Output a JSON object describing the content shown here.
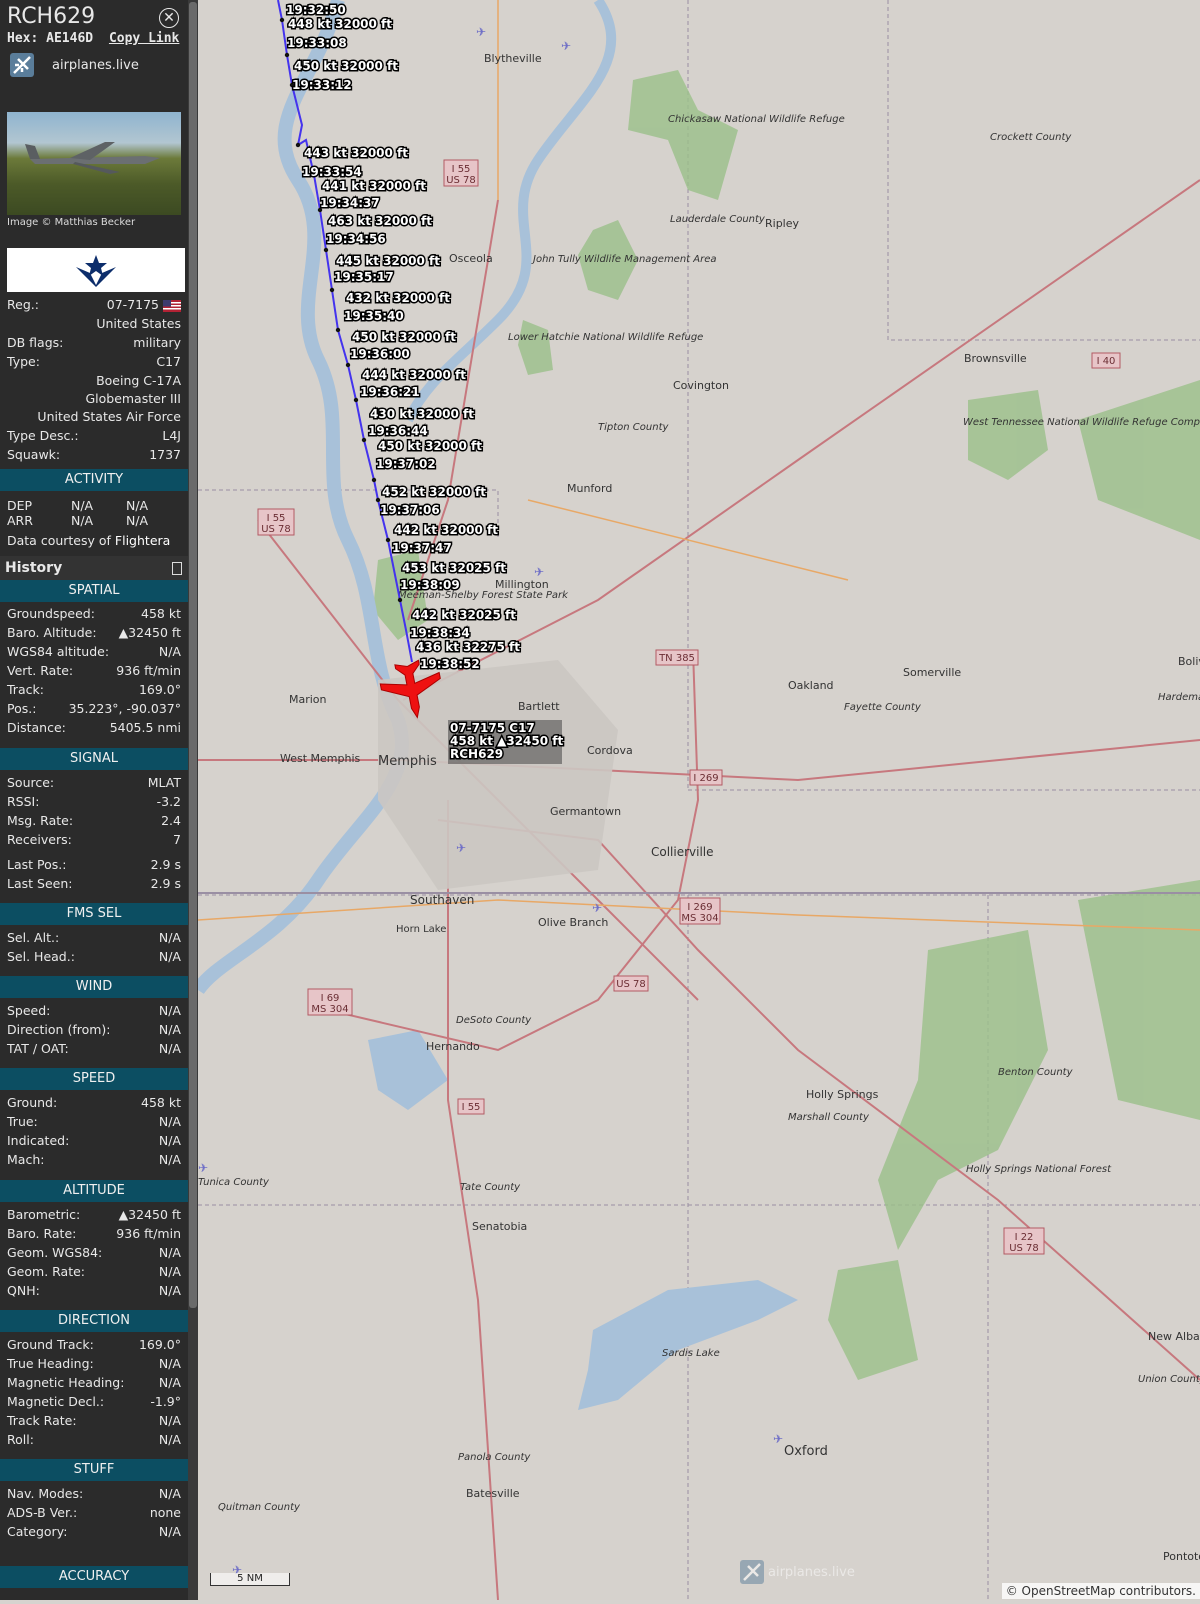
{
  "header": {
    "callsign": "RCH629",
    "hex_label": "Hex:",
    "hex": "AE146D",
    "copy_link": "Copy Link",
    "source_name": "airplanes.live",
    "photo_credit": "Image © Matthias Becker"
  },
  "details": {
    "reg_label": "Reg.:",
    "reg": "07-7175",
    "country": "United States",
    "dbflags_label": "DB flags:",
    "dbflags": "military",
    "type_label": "Type:",
    "type": "C17",
    "type_full": "Boeing C-17A Globemaster III",
    "operator": "United States Air Force",
    "typedesc_label": "Type Desc.:",
    "typedesc": "L4J",
    "squawk_label": "Squawk:",
    "squawk": "1737"
  },
  "activity": {
    "title": "ACTIVITY",
    "dep_label": "DEP",
    "dep1": "N/A",
    "dep2": "N/A",
    "arr_label": "ARR",
    "arr1": "N/A",
    "arr2": "N/A",
    "courtesy_prefix": "Data courtesy of",
    "courtesy_name": "Flightera"
  },
  "history_label": "History",
  "spatial": {
    "title": "SPATIAL",
    "rows": [
      {
        "label": "Groundspeed:",
        "value": "458 kt"
      },
      {
        "label": "Baro. Altitude:",
        "value": "▲32450 ft"
      },
      {
        "label": "WGS84 altitude:",
        "value": "N/A"
      },
      {
        "label": "Vert. Rate:",
        "value": "936 ft/min"
      },
      {
        "label": "Track:",
        "value": "169.0°"
      },
      {
        "label": "Pos.:",
        "value": "35.223°, -90.037°"
      },
      {
        "label": "Distance:",
        "value": "5405.5 nmi"
      }
    ]
  },
  "signal": {
    "title": "SIGNAL",
    "rows": [
      {
        "label": "Source:",
        "value": "MLAT"
      },
      {
        "label": "RSSI:",
        "value": "-3.2"
      },
      {
        "label": "Msg. Rate:",
        "value": "2.4"
      },
      {
        "label": "Receivers:",
        "value": "7"
      },
      {
        "label": "Last Pos.:",
        "value": "2.9 s"
      },
      {
        "label": "Last Seen:",
        "value": "2.9 s"
      }
    ]
  },
  "fms": {
    "title": "FMS SEL",
    "rows": [
      {
        "label": "Sel. Alt.:",
        "value": "N/A"
      },
      {
        "label": "Sel. Head.:",
        "value": "N/A"
      }
    ]
  },
  "wind": {
    "title": "WIND",
    "rows": [
      {
        "label": "Speed:",
        "value": "N/A"
      },
      {
        "label": "Direction (from):",
        "value": "N/A"
      },
      {
        "label": "TAT / OAT:",
        "value": "N/A"
      }
    ]
  },
  "speed": {
    "title": "SPEED",
    "rows": [
      {
        "label": "Ground:",
        "value": "458 kt"
      },
      {
        "label": "True:",
        "value": "N/A"
      },
      {
        "label": "Indicated:",
        "value": "N/A"
      },
      {
        "label": "Mach:",
        "value": "N/A"
      }
    ]
  },
  "altitude": {
    "title": "ALTITUDE",
    "rows": [
      {
        "label": "Barometric:",
        "value": "▲32450 ft"
      },
      {
        "label": "Baro. Rate:",
        "value": "936 ft/min"
      },
      {
        "label": "Geom. WGS84:",
        "value": "N/A"
      },
      {
        "label": "Geom. Rate:",
        "value": "N/A"
      },
      {
        "label": "QNH:",
        "value": "N/A"
      }
    ]
  },
  "direction": {
    "title": "DIRECTION",
    "rows": [
      {
        "label": "Ground Track:",
        "value": "169.0°"
      },
      {
        "label": "True Heading:",
        "value": "N/A"
      },
      {
        "label": "Magnetic Heading:",
        "value": "N/A"
      },
      {
        "label": "Magnetic Decl.:",
        "value": "-1.9°"
      },
      {
        "label": "Track Rate:",
        "value": "N/A"
      },
      {
        "label": "Roll:",
        "value": "N/A"
      }
    ]
  },
  "stuff": {
    "title": "STUFF",
    "rows": [
      {
        "label": "Nav. Modes:",
        "value": "N/A"
      },
      {
        "label": "ADS-B Ver.:",
        "value": "none"
      },
      {
        "label": "Category:",
        "value": "N/A"
      }
    ]
  },
  "accuracy_title": "ACCURACY",
  "map": {
    "trail": [
      {
        "speed": "448 kt",
        "alt": "32000 ft",
        "time": "19:33:08"
      },
      {
        "speed": "450 kt",
        "alt": "32000 ft",
        "time": "19:33:12"
      },
      {
        "speed": "443 kt",
        "alt": "32000 ft",
        "time": "19:33:54"
      },
      {
        "speed": "441 kt",
        "alt": "32000 ft",
        "time": "19:34:37"
      },
      {
        "speed": "463 kt",
        "alt": "32000 ft",
        "time": "19:34:56"
      },
      {
        "speed": "445 kt",
        "alt": "32000 ft",
        "time": "19:35:17"
      },
      {
        "speed": "432 kt",
        "alt": "32000 ft",
        "time": "19:35:40"
      },
      {
        "speed": "450 kt",
        "alt": "32000 ft",
        "time": "19:36:00"
      },
      {
        "speed": "444 kt",
        "alt": "32000 ft",
        "time": "19:36:21"
      },
      {
        "speed": "430 kt",
        "alt": "32000 ft",
        "time": "19:36:44"
      },
      {
        "speed": "450 kt",
        "alt": "32000 ft",
        "time": "19:37:02"
      },
      {
        "speed": "452 kt",
        "alt": "32000 ft",
        "time": "19:37:06"
      },
      {
        "speed": "442 kt",
        "alt": "32000 ft",
        "time": "19:37:47"
      },
      {
        "speed": "453 kt",
        "alt": "32025 ft",
        "time": "19:38:09"
      },
      {
        "speed": "442 kt",
        "alt": "32025 ft",
        "time": "19:38:34"
      },
      {
        "speed": "436 kt",
        "alt": "32275 ft",
        "time": "19:38:52"
      }
    ],
    "top_time": "19:32:50",
    "aircraft_label_line1": "07-7175 C17",
    "aircraft_label_line2": "458 kt ▲32450 ft",
    "aircraft_label_line3": "RCH629",
    "places": [
      "Blytheville",
      "Osceola",
      "Ripley",
      "Covington",
      "Brownsville",
      "Munford",
      "Millington",
      "Marion",
      "Bartlett",
      "Memphis",
      "West Memphis",
      "Cordova",
      "Germantown",
      "Collierville",
      "Southaven",
      "Horn Lake",
      "Olive Branch",
      "Hernando",
      "Senatobia",
      "Holly Springs",
      "Oxford",
      "Batesville",
      "Oakland",
      "Somerville",
      "New Albany",
      "Pontotoc",
      "Bolivar"
    ],
    "counties": [
      "Crockett County",
      "Lauderdale County",
      "Tipton County",
      "Fayette County",
      "Hardeman County",
      "DeSoto County",
      "Marshall County",
      "Benton County",
      "Union County",
      "Tate County",
      "Panola County",
      "Quitman County",
      "Tunica County"
    ],
    "parks": [
      "Chickasaw National Wildlife Refuge",
      "John Tully Wildlife Management Area",
      "Lower Hatchie National Wildlife Refuge",
      "West Tennessee National Wildlife Refuge Complex",
      "Holly Springs National Forest",
      "Sardis Lake",
      "Meeman-Shelby Forest State Park"
    ],
    "shields": [
      "I 55",
      "US 78",
      "I 40",
      "TN 385",
      "I 269",
      "I 69",
      "MS 304",
      "I 22"
    ],
    "scale": "5 NM",
    "attribution_prefix": "© OpenStreetMap",
    "attribution_suffix": "contributors.",
    "watermark": "airplanes.live"
  }
}
